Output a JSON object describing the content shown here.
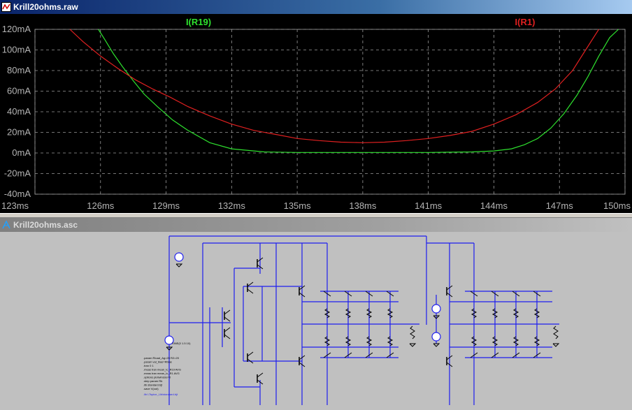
{
  "windows": {
    "waveform": {
      "title": "Krill20ohms.raw"
    },
    "schematic": {
      "title": "Krill20ohms.asc"
    }
  },
  "colors": {
    "plot_bg": "#000000",
    "grid": "#9a9a9a",
    "axis_text": "#b4b4b4",
    "series_green": "#2ee02e",
    "series_red": "#e02020",
    "wire": "#1e1ef0",
    "schematic_bg": "#c0c0c0"
  },
  "chart_data": {
    "type": "line",
    "x_ticks": [
      "123ms",
      "126ms",
      "129ms",
      "132ms",
      "135ms",
      "138ms",
      "141ms",
      "144ms",
      "147ms",
      "150ms"
    ],
    "y_ticks": [
      "120mA",
      "100mA",
      "80mA",
      "60mA",
      "40mA",
      "20mA",
      "0mA",
      "-20mA",
      "-40mA"
    ],
    "xlim": [
      123,
      150
    ],
    "ylim": [
      -40,
      120
    ],
    "grid": true,
    "series": [
      {
        "name": "I(R19)",
        "color": "#2ee02e",
        "x": [
          125.9,
          126.2,
          126.6,
          127.0,
          127.5,
          128.0,
          128.6,
          129.3,
          130.0,
          131.0,
          132.0,
          133.5,
          135,
          137,
          139,
          141,
          143,
          144.0,
          144.8,
          145.4,
          146.0,
          146.6,
          147.2,
          147.8,
          148.3,
          148.8,
          149.3,
          149.7
        ],
        "y": [
          120,
          110,
          96,
          84,
          70,
          57,
          45,
          32,
          22,
          10,
          4,
          1,
          0.5,
          0.5,
          0.5,
          0.5,
          1,
          2,
          4,
          8,
          14,
          24,
          38,
          56,
          74,
          94,
          112,
          120
        ]
      },
      {
        "name": "I(R1)",
        "color": "#e02020",
        "x": [
          124.6,
          125.2,
          126.0,
          126.8,
          127.6,
          128.4,
          129.2,
          130.0,
          131.0,
          132.0,
          133.0,
          134.0,
          135.0,
          136.0,
          137.0,
          138.0,
          139.0,
          140.0,
          141.0,
          142.0,
          143.0,
          144.0,
          145.0,
          146.0,
          146.8,
          147.6,
          148.2,
          148.8
        ],
        "y": [
          120,
          108,
          94,
          82,
          71,
          62,
          54,
          45,
          36,
          28,
          22,
          18,
          14,
          12,
          10.5,
          10,
          10.5,
          12,
          14,
          17,
          21,
          28,
          37,
          49,
          62,
          80,
          100,
          120
        ]
      }
    ]
  },
  "schematic": {
    "netlist_notes": [
      ".param Rload_Ag=20 R2=20",
      ".param val_bias=Rbias",
      ".tran 0 1",
      ".meas tran mean_Ic_R19 AVG",
      ".meas tran mean_Ic_R1 AVG",
      ".options plotwinsize=0",
      ".step param Rb",
      ".lib standard.bjt",
      ".save V(out)"
    ],
    "lib_text": ".lib LTspice_Lib/standard.bjt",
    "source_label": "SINE(0 1.5 10)"
  }
}
